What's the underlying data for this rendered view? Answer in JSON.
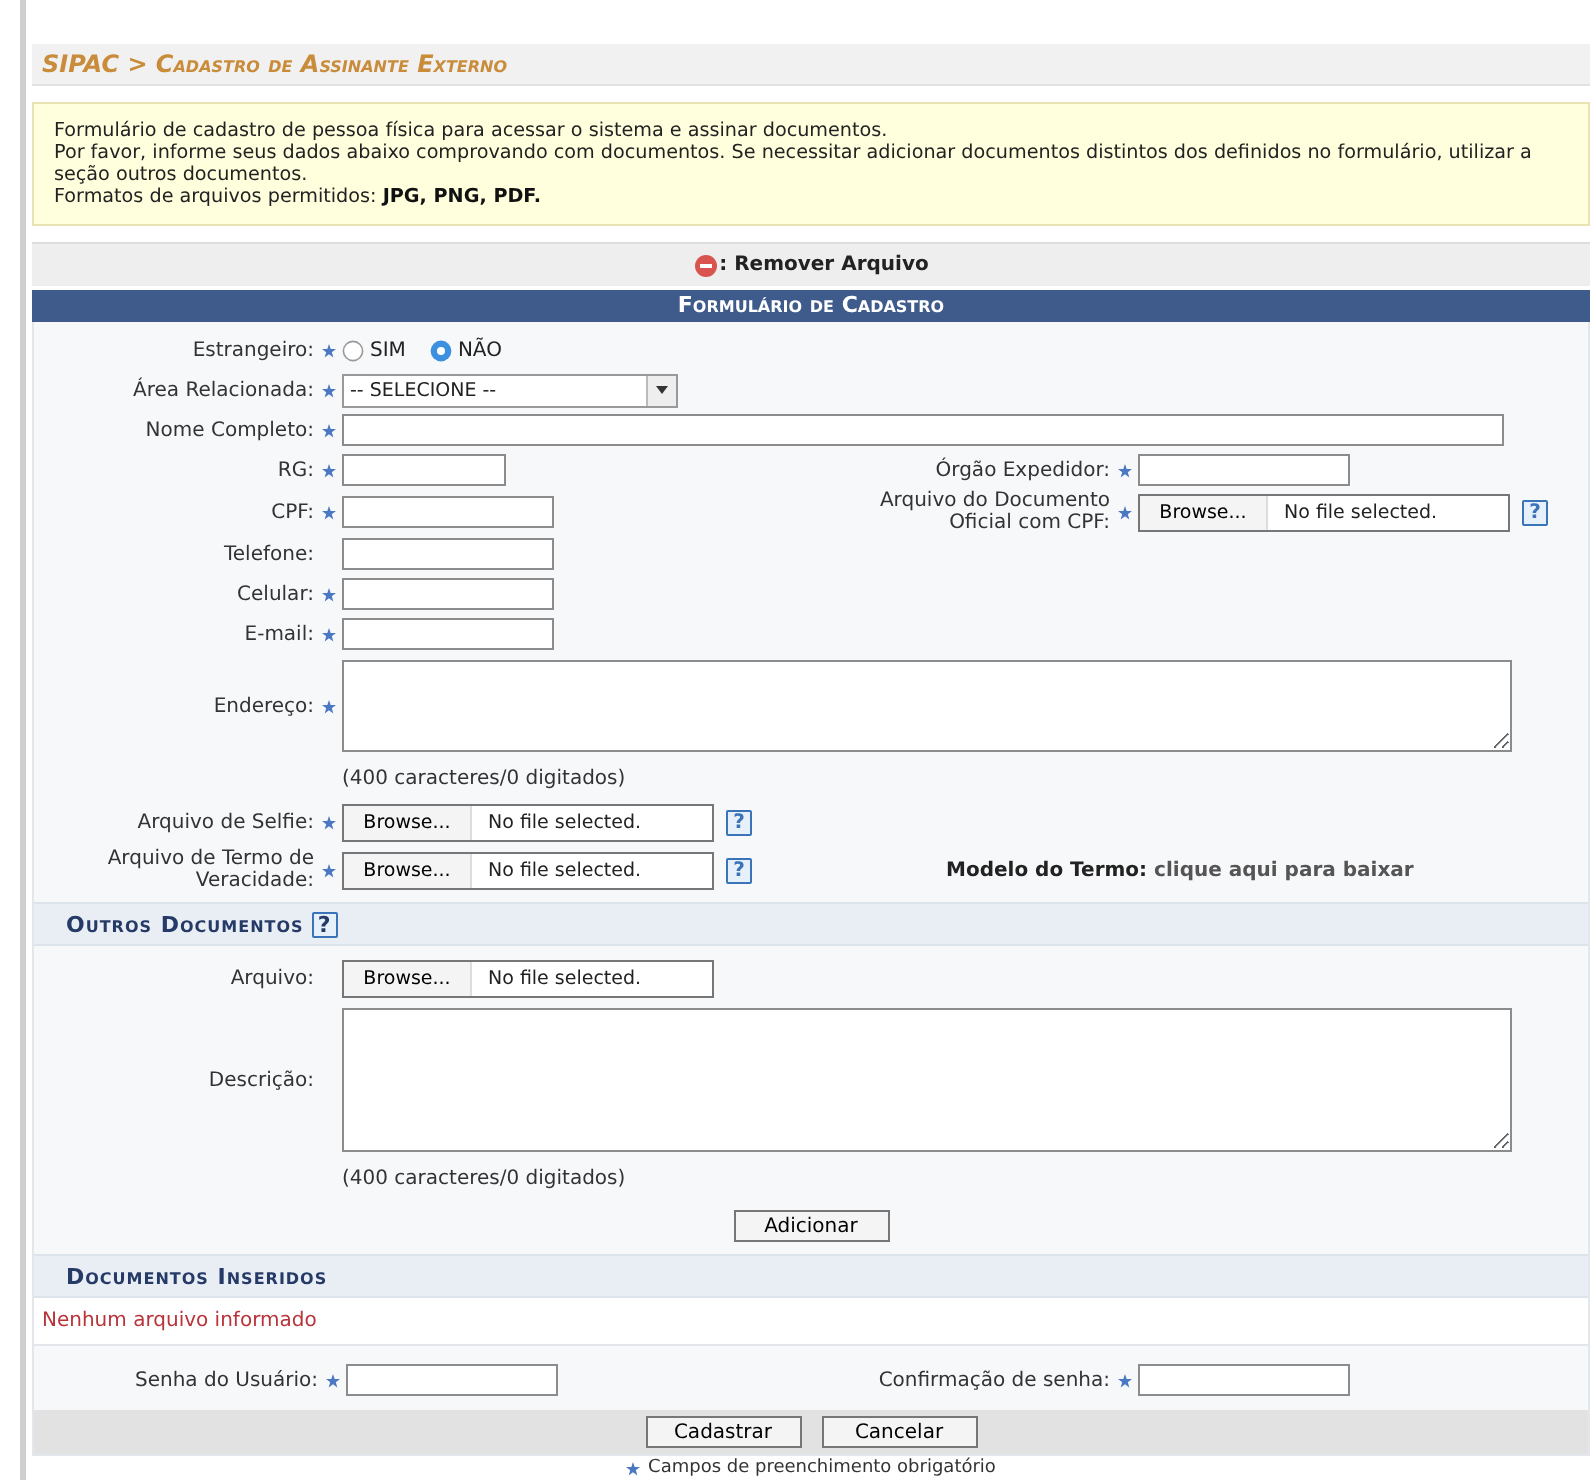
{
  "breadcrumb": "SIPAC > Cadastro de Assinante Externo",
  "info": {
    "lines": [
      "Formulário de cadastro de pessoa física para acessar o sistema e assinar documentos.",
      "Por favor, informe seus dados abaixo comprovando com documentos. Se necessitar adicionar documentos distintos dos definidos no formulário, utilizar a seção outros documentos.",
      "Formatos de arquivos permitidos: **JPG, PNG, PDF.**"
    ]
  },
  "legend": {
    "label": ": Remover Arquivo"
  },
  "form": {
    "title": "Formulário de Cadastro",
    "rows": [
      {
        "left": {
          "kind": "radio",
          "label": "Estrangeiro:",
          "required": true,
          "options": [
            {
              "label": "SIM",
              "selected": false
            },
            {
              "label": "NÃO",
              "selected": true
            }
          ]
        }
      },
      {
        "left": {
          "kind": "select",
          "label": "Área Relacionada:",
          "required": true,
          "value": "-- SELECIONE --"
        }
      },
      {
        "left": {
          "kind": "wide-text",
          "label": "Nome Completo:",
          "required": true
        }
      },
      {
        "left": {
          "kind": "short-text",
          "label": "RG:",
          "required": true
        },
        "right": {
          "kind": "text",
          "label": "Órgão Expedidor:",
          "required": true
        }
      },
      {
        "left": {
          "kind": "text",
          "label": "CPF:",
          "required": true
        },
        "right": {
          "kind": "file",
          "label": "Arquivo do Documento Oficial com CPF:",
          "required": true,
          "button": "Browse...",
          "status": "No file selected.",
          "help": "?"
        }
      },
      {
        "left": {
          "kind": "text",
          "label": "Telefone:",
          "required": false
        }
      },
      {
        "left": {
          "kind": "text",
          "label": "Celular:",
          "required": true
        }
      },
      {
        "left": {
          "kind": "text",
          "label": "E-mail:",
          "required": true
        }
      },
      {
        "left": {
          "kind": "textarea",
          "label": "Endereço:",
          "required": true
        }
      },
      {
        "left": {
          "kind": "note",
          "text": "(400 caracteres/0 digitados)"
        }
      },
      {
        "left": {
          "kind": "file",
          "label": "Arquivo de Selfie:",
          "required": true,
          "button": "Browse...",
          "status": "No file selected.",
          "help": "?"
        }
      },
      {
        "left": {
          "kind": "file",
          "label": "Arquivo de Termo de Veracidade:",
          "required": true,
          "button": "Browse...",
          "status": "No file selected.",
          "help": "?"
        },
        "right": {
          "kind": "download",
          "label": "Modelo do Termo:",
          "link": "clique aqui para baixar"
        }
      }
    ],
    "other_documents": {
      "title": "Outros Documentos",
      "help": "?",
      "rows": [
        {
          "left": {
            "kind": "file",
            "label": "Arquivo:",
            "required": false,
            "button": "Browse...",
            "status": "No file selected."
          }
        },
        {
          "left": {
            "kind": "textarea",
            "label": "Descrição:",
            "required": false
          }
        },
        {
          "left": {
            "kind": "note",
            "text": "(400 caracteres/0 digitados)"
          }
        }
      ],
      "button": "Adicionar"
    },
    "inserted_documents": {
      "title": "Documentos Inseridos",
      "empty_message": "Nenhum arquivo informado"
    },
    "password_row": {
      "left": {
        "kind": "password",
        "label": "Senha do Usuário:",
        "required": true
      },
      "right": {
        "kind": "password",
        "label": "Confirmação de senha:",
        "required": true
      }
    },
    "buttons": [
      "Cadastrar",
      "Cancelar"
    ]
  },
  "footer_note": "Campos de preenchimento obrigatório"
}
